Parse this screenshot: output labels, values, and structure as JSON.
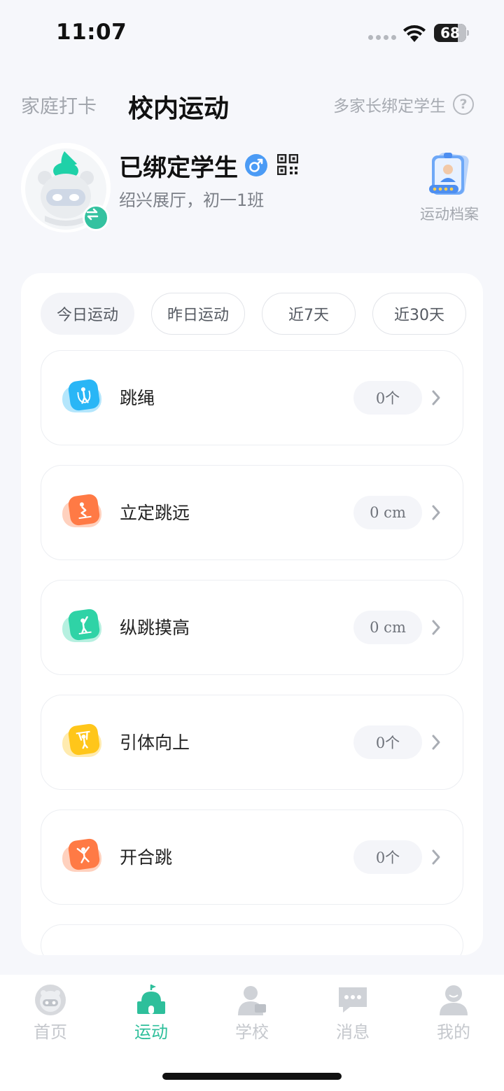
{
  "status_bar": {
    "time": "11:07",
    "battery": "68"
  },
  "header": {
    "tab_family": "家庭打卡",
    "tab_school": "校内运动",
    "multi_parent": "多家长绑定学生",
    "help_icon": "?"
  },
  "student": {
    "name": "已绑定学生",
    "class": "绍兴展厅，初一1班",
    "gender_symbol": "♂",
    "archive_label": "运动档案"
  },
  "filters": [
    "今日运动",
    "昨日运动",
    "近7天",
    "近30天"
  ],
  "active_filter": "今日运动",
  "exercises": [
    {
      "name": "跳绳",
      "value": "0个",
      "icon": "jump-rope-icon",
      "color": "#29b6f6"
    },
    {
      "name": "立定跳远",
      "value": "0 cm",
      "icon": "standing-long-jump-icon",
      "color": "#ff7a45"
    },
    {
      "name": "纵跳摸高",
      "value": "0 cm",
      "icon": "vertical-jump-icon",
      "color": "#2fd3a6"
    },
    {
      "name": "引体向上",
      "value": "0个",
      "icon": "pull-up-icon",
      "color": "#ffc61a"
    },
    {
      "name": "开合跳",
      "value": "0个",
      "icon": "jumping-jack-icon",
      "color": "#ff7a45"
    }
  ],
  "nav": {
    "home": "首页",
    "sport": "运动",
    "school": "学校",
    "message": "消息",
    "mine": "我的",
    "active_color": "#2ebf9b",
    "inactive_color": "#c5c8cd"
  }
}
